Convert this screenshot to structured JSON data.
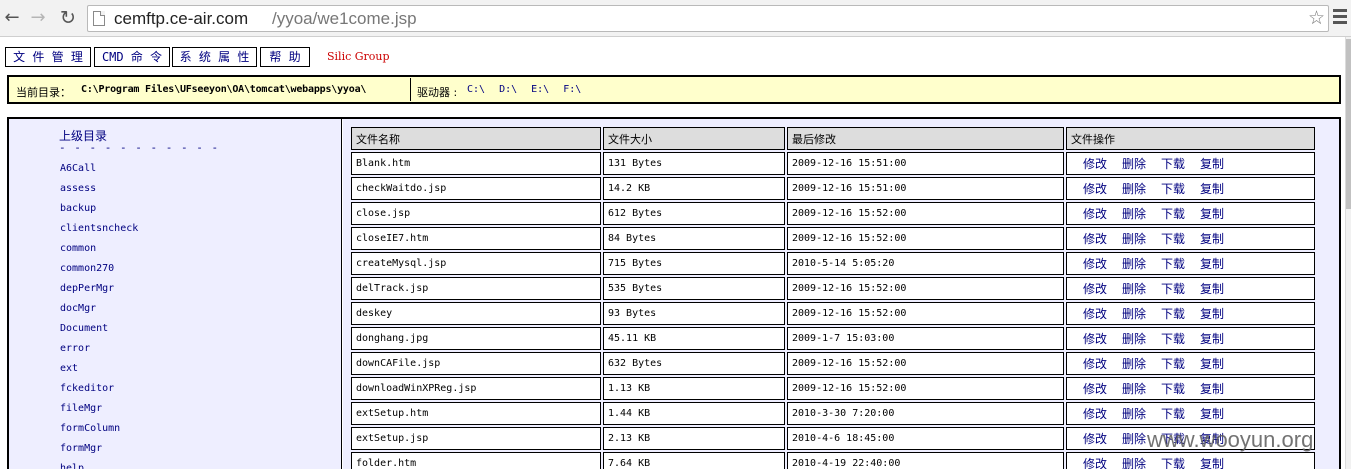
{
  "browser": {
    "url_host": "cemftp.ce-air.com",
    "url_path": "/yyoa/we1come.jsp",
    "back": "←",
    "forward": "→",
    "reload": "↻",
    "star": "☆"
  },
  "menu": {
    "file_manager": "文 件 管 理",
    "cmd": "CMD 命 令",
    "sys_props": "系 统 属 性",
    "help": "帮 助",
    "silic": "Silic Group"
  },
  "pathbar": {
    "current_label": "当前目录：",
    "current_path": "C:\\Program Files\\UFseeyon\\OA\\tomcat\\webapps\\yyoa\\",
    "drive_label": "驱动器 :",
    "drives": [
      "C:\\",
      "D:\\",
      "E:\\",
      "F:\\"
    ]
  },
  "dirs": {
    "parent": "上级目录",
    "separator": "- - - - - - - - - - -",
    "items": [
      "A6Call",
      "assess",
      "backup",
      "clientsncheck",
      "common",
      "common270",
      "depPerMgr",
      "docMgr",
      "Document",
      "error",
      "ext",
      "fckeditor",
      "fileMgr",
      "formColumn",
      "formMgr",
      "help"
    ]
  },
  "files": {
    "headers": [
      "文件名称",
      "文件大小",
      "最后修改",
      "文件操作"
    ],
    "ops": [
      "修改",
      "删除",
      "下载",
      "复制"
    ],
    "rows": [
      {
        "name": "Blank.htm",
        "size": "131 Bytes",
        "modified": "2009-12-16 15:51:00"
      },
      {
        "name": "checkWaitdo.jsp",
        "size": "14.2 KB",
        "modified": "2009-12-16 15:51:00"
      },
      {
        "name": "close.jsp",
        "size": "612 Bytes",
        "modified": "2009-12-16 15:52:00"
      },
      {
        "name": "closeIE7.htm",
        "size": "84 Bytes",
        "modified": "2009-12-16 15:52:00"
      },
      {
        "name": "createMysql.jsp",
        "size": "715 Bytes",
        "modified": "2010-5-14 5:05:20"
      },
      {
        "name": "delTrack.jsp",
        "size": "535 Bytes",
        "modified": "2009-12-16 15:52:00"
      },
      {
        "name": "deskey",
        "size": "93 Bytes",
        "modified": "2009-12-16 15:52:00"
      },
      {
        "name": "donghang.jpg",
        "size": "45.11 KB",
        "modified": "2009-1-7 15:03:00"
      },
      {
        "name": "downCAFile.jsp",
        "size": "632 Bytes",
        "modified": "2009-12-16 15:52:00"
      },
      {
        "name": "downloadWinXPReg.jsp",
        "size": "1.13 KB",
        "modified": "2009-12-16 15:52:00"
      },
      {
        "name": "extSetup.htm",
        "size": "1.44 KB",
        "modified": "2010-3-30 7:20:00"
      },
      {
        "name": "extSetup.jsp",
        "size": "2.13 KB",
        "modified": "2010-4-6 18:45:00"
      },
      {
        "name": "folder.htm",
        "size": "7.64 KB",
        "modified": "2010-4-19 22:40:00"
      }
    ]
  },
  "watermark": "www.wooyun.org"
}
